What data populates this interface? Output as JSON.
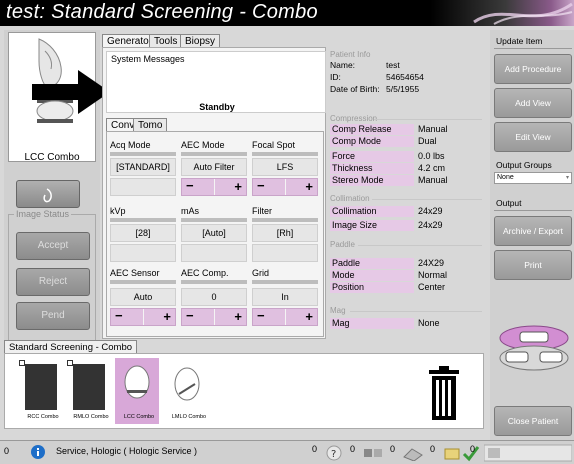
{
  "window": {
    "title": "test: Standard Screening - Combo"
  },
  "left": {
    "view_label": "LCC Combo",
    "image_status_label": "Image Status",
    "buttons": {
      "accept": "Accept",
      "reject": "Reject",
      "pend": "Pend"
    }
  },
  "tabs": {
    "main": [
      "Generator",
      "Tools",
      "Biopsy"
    ],
    "sub": [
      "Conv",
      "Tomo"
    ]
  },
  "system_messages": {
    "label": "System Messages",
    "status": "Standby"
  },
  "controls": {
    "acq_mode": {
      "label": "Acq Mode",
      "value": "[STANDARD]"
    },
    "aec_mode": {
      "label": "AEC Mode",
      "value": "Auto Filter"
    },
    "focal_spot": {
      "label": "Focal Spot",
      "value": "LFS"
    },
    "kvp": {
      "label": "kVp",
      "value": "[28]"
    },
    "mas": {
      "label": "mAs",
      "value": "[Auto]"
    },
    "filter": {
      "label": "Filter",
      "value": "[Rh]"
    },
    "aec_sensor": {
      "label": "AEC Sensor",
      "value": "Auto"
    },
    "aec_comp": {
      "label": "AEC Comp.",
      "value": "0"
    },
    "grid": {
      "label": "Grid",
      "value": "In"
    },
    "minus": "−",
    "plus": "+"
  },
  "patient": {
    "section_label": "Patient Info",
    "name_label": "Name:",
    "name": "test",
    "id_label": "ID:",
    "id": "54654654",
    "dob_label": "Date of Birth:",
    "dob": "5/5/1955"
  },
  "compression": {
    "section_label": "Compression",
    "rows": [
      {
        "name": "Comp Release",
        "value": "Manual"
      },
      {
        "name": "Comp Mode",
        "value": "Dual"
      },
      {
        "name": "Force",
        "value": "0.0 lbs"
      },
      {
        "name": "Thickness",
        "value": "4.2 cm"
      },
      {
        "name": "Stereo Mode",
        "value": "Manual"
      }
    ]
  },
  "collimation": {
    "section_label": "Collimation",
    "rows": [
      {
        "name": "Collimation",
        "value": "24x29"
      },
      {
        "name": "Image Size",
        "value": "24x29"
      }
    ]
  },
  "paddle": {
    "section_label": "Paddle",
    "rows": [
      {
        "name": "Paddle",
        "value": "24X29"
      },
      {
        "name": "Mode",
        "value": "Normal"
      },
      {
        "name": "Position",
        "value": "Center"
      }
    ]
  },
  "mag": {
    "section_label": "Mag",
    "rows": [
      {
        "name": "Mag",
        "value": "None"
      }
    ]
  },
  "right": {
    "update_item_label": "Update Item",
    "add_procedure": "Add Procedure",
    "add_view": "Add View",
    "edit_view": "Edit View",
    "output_groups_label": "Output Groups",
    "output_groups_value": "None",
    "output_label": "Output",
    "archive_export": "Archive / Export",
    "print": "Print",
    "close_patient": "Close Patient"
  },
  "procedure": {
    "tab_label": "Standard Screening - Combo",
    "thumbnails": [
      {
        "label": "RCC Combo"
      },
      {
        "label": "RMLO Combo"
      },
      {
        "label": "LCC Combo"
      },
      {
        "label": "LMLO Combo"
      }
    ]
  },
  "statusbar": {
    "left_value": "0",
    "user": "Service, Hologic ( Hologic Service )",
    "counts": [
      "0",
      "0",
      "0",
      "0",
      "0"
    ]
  },
  "colors": {
    "pink_accent": "#e0c0e0",
    "selected_thumb": "#d8a8d8",
    "title_bg": "#000000"
  }
}
